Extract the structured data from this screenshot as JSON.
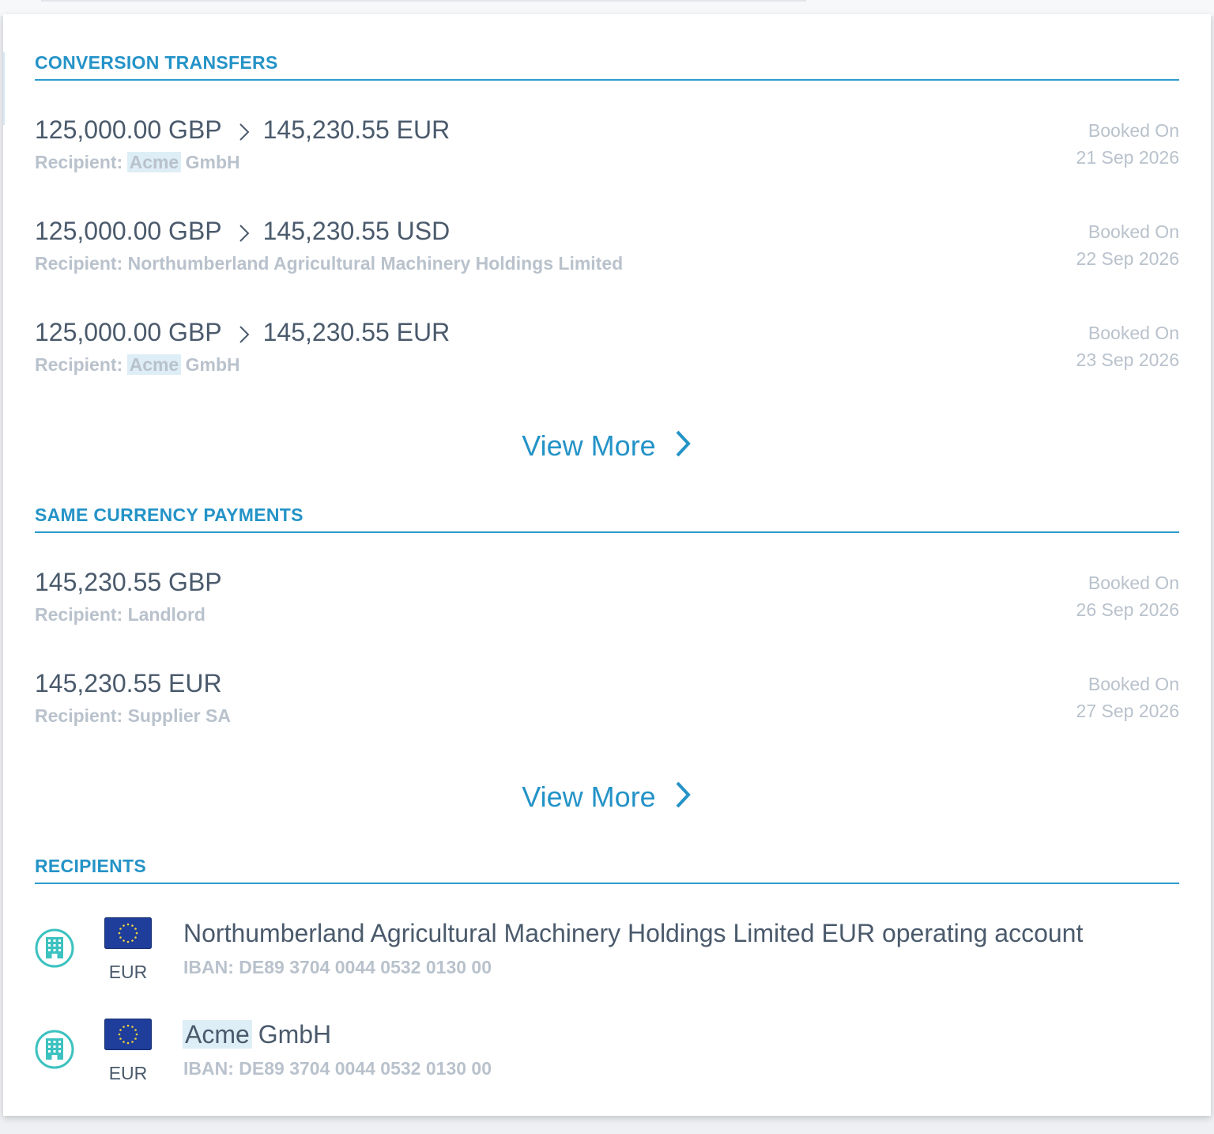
{
  "conversion_transfers": {
    "title": "CONVERSION TRANSFERS",
    "items": [
      {
        "from_amount": "125,000.00 GBP",
        "to_amount": "145,230.55 EUR",
        "recipient_label": "Recipient:",
        "recipient_highlight": "Acme",
        "recipient_rest": " GmbH",
        "booked_label": "Booked On",
        "booked_date": "21 Sep 2026"
      },
      {
        "from_amount": "125,000.00 GBP",
        "to_amount": "145,230.55 USD",
        "recipient_label": "Recipient:",
        "recipient_highlight": "",
        "recipient_rest": "Northumberland Agricultural Machinery Holdings Limited",
        "booked_label": "Booked On",
        "booked_date": "22 Sep 2026"
      },
      {
        "from_amount": "125,000.00 GBP",
        "to_amount": "145,230.55 EUR",
        "recipient_label": "Recipient:",
        "recipient_highlight": "Acme",
        "recipient_rest": " GmbH",
        "booked_label": "Booked On",
        "booked_date": "23 Sep 2026"
      }
    ],
    "view_more": "View More"
  },
  "same_currency_payments": {
    "title": "SAME CURRENCY PAYMENTS",
    "items": [
      {
        "amount": "145,230.55 GBP",
        "recipient_label": "Recipient:",
        "recipient": "Landlord",
        "booked_label": "Booked On",
        "booked_date": "26 Sep 2026"
      },
      {
        "amount": "145,230.55 EUR",
        "recipient_label": "Recipient:",
        "recipient": "Supplier SA",
        "booked_label": "Booked On",
        "booked_date": "27 Sep 2026"
      }
    ],
    "view_more": "View More"
  },
  "recipients": {
    "title": "RECIPIENTS",
    "items": [
      {
        "icon": "bank-building-icon",
        "flag": "eu-flag-icon",
        "currency": "EUR",
        "name_highlight": "",
        "name_rest": "Northumberland Agricultural Machinery Holdings Limited EUR operating account",
        "iban": "IBAN: DE89 3704 0044 0532 0130 00"
      },
      {
        "icon": "bank-building-icon",
        "flag": "eu-flag-icon",
        "currency": "EUR",
        "name_highlight": "Acme",
        "name_rest": " GmbH",
        "iban": "IBAN: DE89 3704 0044 0532 0130 00"
      }
    ]
  },
  "colors": {
    "accent": "#2493c7",
    "primary_text": "#4a5a6c",
    "muted_text": "#b9c2cc",
    "highlight": "#deeef7",
    "icon_teal": "#3cc2c0",
    "flag_blue": "#1f3d9a",
    "flag_star": "#f2d43a"
  }
}
